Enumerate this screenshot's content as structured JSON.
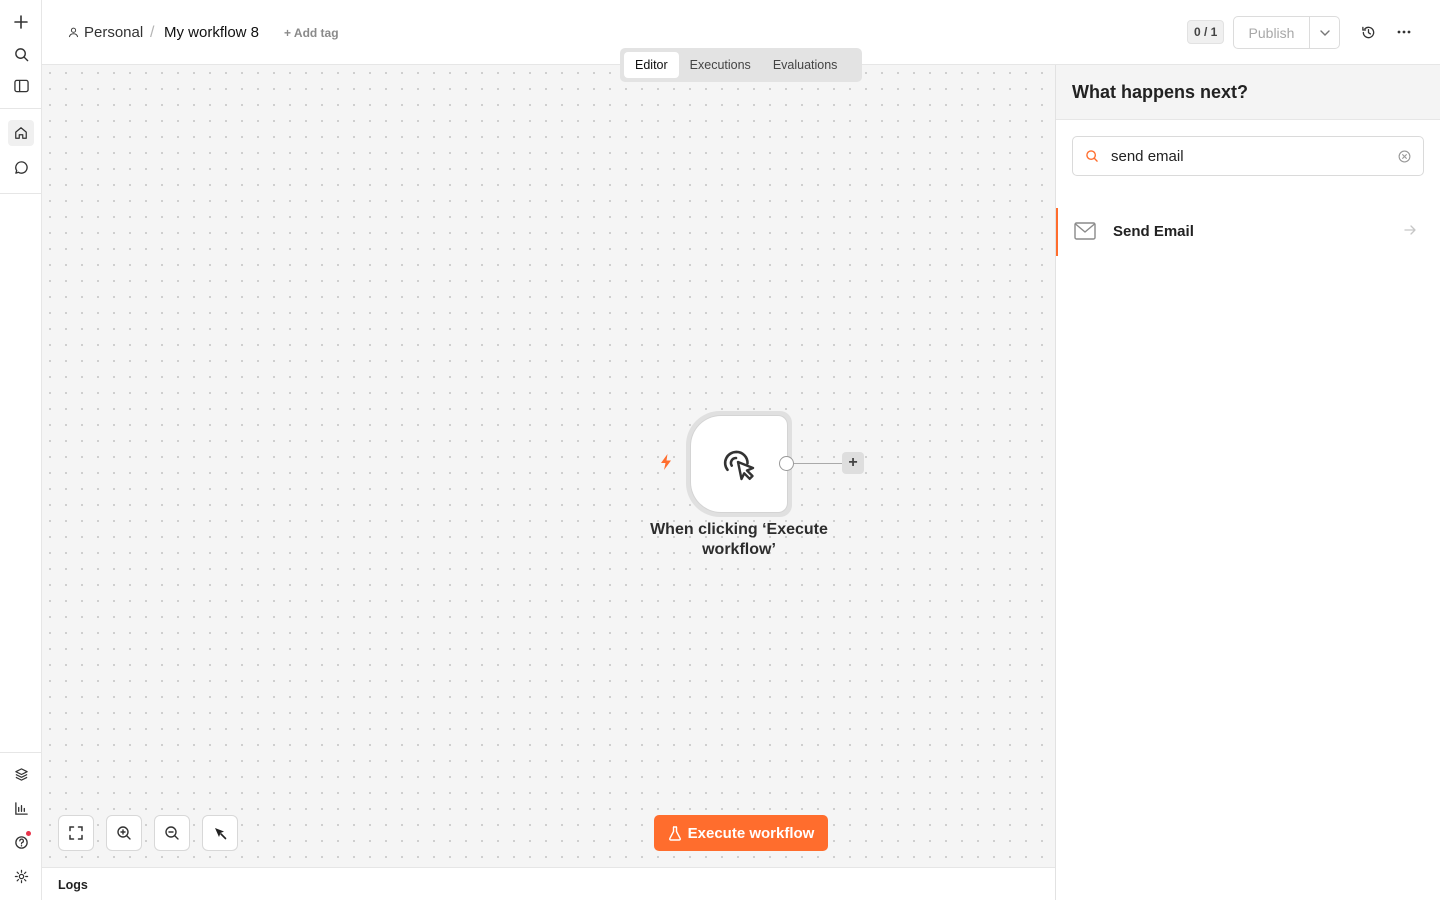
{
  "breadcrumb": {
    "project": "Personal",
    "separator": "/",
    "workflow_name": "My workflow 8"
  },
  "header": {
    "add_tag": "+ Add tag",
    "counter": "0 / 1",
    "publish_label": "Publish"
  },
  "tabs": [
    {
      "label": "Editor",
      "active": true
    },
    {
      "label": "Executions",
      "active": false
    },
    {
      "label": "Evaluations",
      "active": false
    }
  ],
  "node": {
    "name": "When clicking ‘Execute workflow’",
    "icon": "pointer-click-icon"
  },
  "canvas_controls": {
    "execute_label": "Execute workflow"
  },
  "logs": {
    "label": "Logs"
  },
  "panel": {
    "title": "What happens next?",
    "search_value": "send email",
    "results": [
      {
        "label": "Send Email",
        "icon": "envelope-icon"
      }
    ]
  },
  "colors": {
    "accent": "#ff6d2d",
    "canvas_bg": "#f5f5f5",
    "notification": "#e8334a"
  }
}
